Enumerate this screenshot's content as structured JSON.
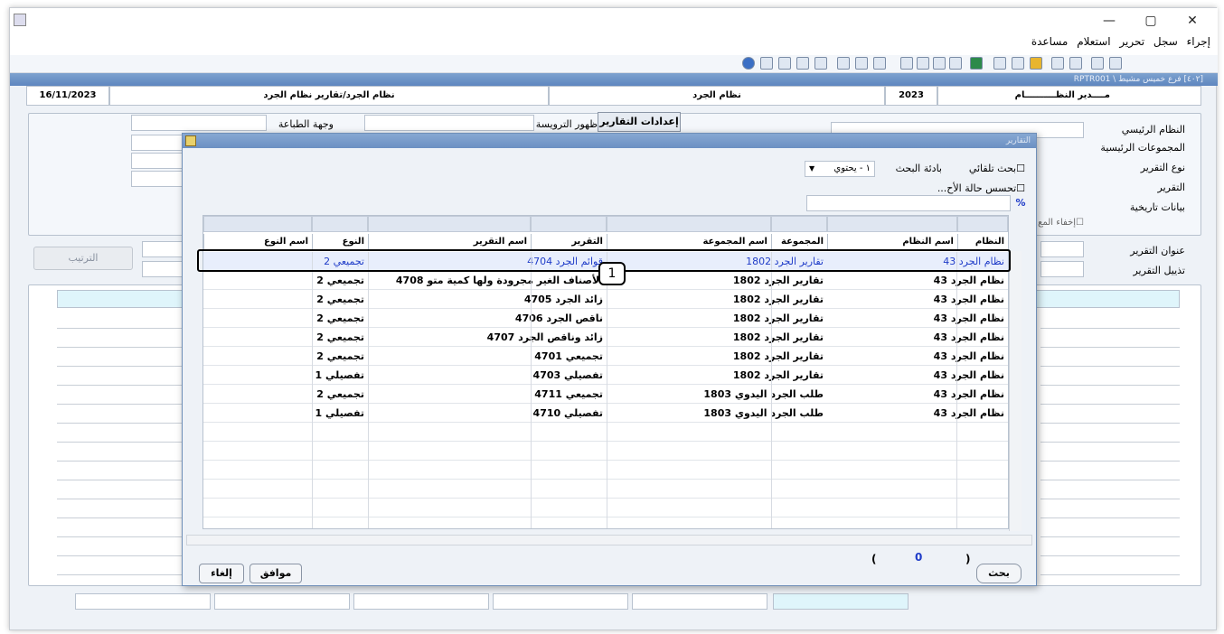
{
  "window": {
    "minimize": "—",
    "maximize": "▢",
    "close": "✕"
  },
  "menu": [
    "إجراء",
    "سجل",
    "تحرير",
    "استعلام",
    "مساعدة"
  ],
  "inner_title": "[٤٠٢] فرع خميس مشيط \\ RPTR001",
  "header": {
    "date": "16/11/2023",
    "path": "نظام الجرد/تقارير نظام الجرد",
    "system": "نظام الجرد",
    "year": "2023",
    "role": "مــــدير النظــــــــــام"
  },
  "form": {
    "labels": [
      "النظام الرئيسي",
      "المجموعات الرئيسية",
      "نوع التقرير",
      "التقرير",
      "بيانات تاريخية"
    ],
    "hide_label": "إخفاء المع",
    "report_title_label": "عنوان التقرير",
    "report_footer_label": "تذييل التقرير",
    "settings_tab": "إعدادات التقارير",
    "header_appear_label": "ظهور الترويسة",
    "print_dest_label": "وجهة الطباعة",
    "sort_button": "الترتيب"
  },
  "dialog": {
    "title": "التقارير",
    "auto_search": "بحث تلقائي",
    "search_tool_label": "بادئة البحث",
    "search_tool_value": "١ - يحتوي",
    "sense_state": "تحسس حالة الأح...",
    "percent": "%",
    "columns": [
      "النظام",
      "اسم النظام",
      "المجموعة",
      "اسم المجموعة",
      "التقرير",
      "اسم التقرير",
      "النوع",
      "اسم النوع"
    ],
    "rows": [
      [
        "43 نظام الجرد",
        "1802 تقارير الجرد",
        "4704 قوائم الجرد",
        "2 تجميعي"
      ],
      [
        "43 نظام الجرد",
        "1802 تقارير الجرد",
        "4708 الأصناف الغير مجرودة ولها كمية متو",
        "2 تجميعي"
      ],
      [
        "43 نظام الجرد",
        "1802 تقارير الجرد",
        "4705 زائد الجرد",
        "2 تجميعي"
      ],
      [
        "43 نظام الجرد",
        "1802 تقارير الجرد",
        "4706 ناقص الجرد",
        "2 تجميعي"
      ],
      [
        "43 نظام الجرد",
        "1802 تقارير الجرد",
        "4707 زائد وناقص الجرد",
        "2 تجميعي"
      ],
      [
        "43 نظام الجرد",
        "1802 تقارير الجرد",
        "4701 تجميعي",
        "2 تجميعي"
      ],
      [
        "43 نظام الجرد",
        "1802 تقارير الجرد",
        "4703 تفصيلي",
        "1 تفصيلي"
      ],
      [
        "43 نظام الجرد",
        "1803 طلب الجرد اليدوي",
        "4711 تجميعي",
        "2 تجميعي"
      ],
      [
        "43 نظام الجرد",
        "1803 طلب الجرد اليدوي",
        "4710 تفصيلي",
        "1 تفصيلي"
      ]
    ],
    "count_open": "(",
    "count": "0",
    "count_close": ")",
    "search_button": "بحث",
    "ok_button": "موافق",
    "cancel_button": "إلغاء"
  },
  "callout": "1"
}
